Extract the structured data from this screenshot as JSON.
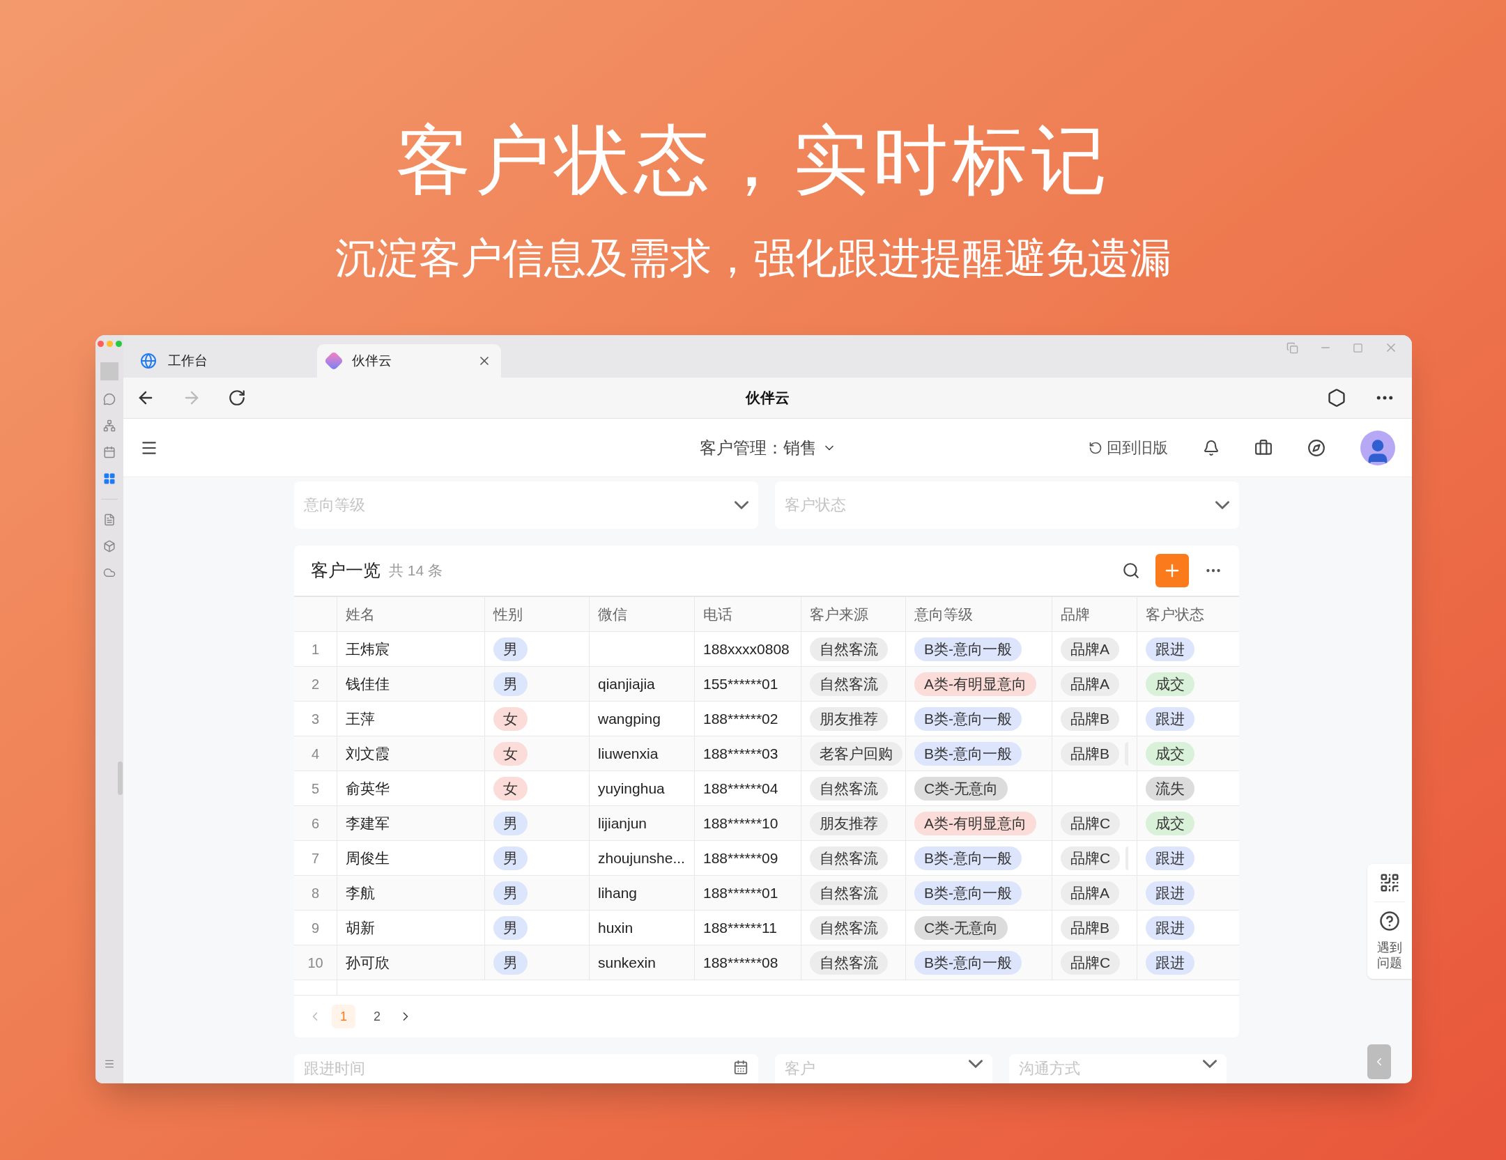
{
  "headline": "客户状态，实时标记",
  "subheadline": "沉淀客户信息及需求，强化跟进提醒避免遗漏",
  "browser": {
    "tabs": [
      {
        "label": "工作台",
        "selected": false
      },
      {
        "label": "伙伴云",
        "selected": true
      }
    ],
    "page_title": "伙伴云",
    "forward_disabled": true
  },
  "sidebar": {
    "items": [
      {
        "selected": false
      },
      {
        "selected": false
      },
      {
        "selected": false
      },
      {
        "selected": true
      },
      {
        "selected": false
      },
      {
        "selected": false
      },
      {
        "selected": false
      }
    ]
  },
  "app_header": {
    "title": "客户管理：销售",
    "legacy_link": "回到旧版"
  },
  "filters_top": [
    {
      "placeholder": "意向等级",
      "kind": "select"
    },
    {
      "placeholder": "客户状态",
      "kind": "select"
    }
  ],
  "table": {
    "title": "客户一览",
    "count": "共 14 条",
    "columns": [
      "姓名",
      "性别",
      "微信",
      "电话",
      "客户来源",
      "意向等级",
      "品牌",
      "客户状态"
    ],
    "rows": [
      {
        "index": "1",
        "name": "王炜宸",
        "gender": {
          "text": "男",
          "color": "#dbe5fc"
        },
        "wechat": "",
        "phone": "188xxxx0808",
        "source": "自然客流",
        "intent": {
          "text": "B类-意向一般",
          "color": "#dde5fd"
        },
        "brand": "品牌A",
        "more_brands": false,
        "status": {
          "text": "跟进",
          "color": "#dde5fd"
        }
      },
      {
        "index": "2",
        "name": "钱佳佳",
        "gender": {
          "text": "男",
          "color": "#dbe5fc"
        },
        "wechat": "qianjiajia",
        "phone": "155******01",
        "source": "自然客流",
        "intent": {
          "text": "A类-有明显意向",
          "color": "#fcdcd8"
        },
        "brand": "品牌A",
        "more_brands": false,
        "status": {
          "text": "成交",
          "color": "#d9f1d9"
        }
      },
      {
        "index": "3",
        "name": "王萍",
        "gender": {
          "text": "女",
          "color": "#fcdcd8"
        },
        "wechat": "wangping",
        "phone": "188******02",
        "source": "朋友推荐",
        "intent": {
          "text": "B类-意向一般",
          "color": "#dde5fd"
        },
        "brand": "品牌B",
        "more_brands": false,
        "status": {
          "text": "跟进",
          "color": "#dde5fd"
        }
      },
      {
        "index": "4",
        "name": "刘文霞",
        "gender": {
          "text": "女",
          "color": "#fcdcd8"
        },
        "wechat": "liuwenxia",
        "phone": "188******03",
        "source": "老客户回购",
        "intent": {
          "text": "B类-意向一般",
          "color": "#dde5fd"
        },
        "brand": "品牌B",
        "more_brands": true,
        "status": {
          "text": "成交",
          "color": "#d9f1d9"
        }
      },
      {
        "index": "5",
        "name": "俞英华",
        "gender": {
          "text": "女",
          "color": "#fcdcd8"
        },
        "wechat": "yuyinghua",
        "phone": "188******04",
        "source": "自然客流",
        "intent": {
          "text": "C类-无意向",
          "color": "#dcdcdc"
        },
        "brand": "",
        "more_brands": false,
        "status": {
          "text": "流失",
          "color": "#dcdcdc"
        }
      },
      {
        "index": "6",
        "name": "李建军",
        "gender": {
          "text": "男",
          "color": "#dbe5fc"
        },
        "wechat": "lijianjun",
        "phone": "188******10",
        "source": "朋友推荐",
        "intent": {
          "text": "A类-有明显意向",
          "color": "#fcdcd8"
        },
        "brand": "品牌C",
        "more_brands": false,
        "status": {
          "text": "成交",
          "color": "#d9f1d9"
        }
      },
      {
        "index": "7",
        "name": "周俊生",
        "gender": {
          "text": "男",
          "color": "#dbe5fc"
        },
        "wechat": "zhoujunshe...",
        "phone": "188******09",
        "source": "自然客流",
        "intent": {
          "text": "B类-意向一般",
          "color": "#dde5fd"
        },
        "brand": "品牌C",
        "more_brands": true,
        "status": {
          "text": "跟进",
          "color": "#dde5fd"
        }
      },
      {
        "index": "8",
        "name": "李航",
        "gender": {
          "text": "男",
          "color": "#dbe5fc"
        },
        "wechat": "lihang",
        "phone": "188******01",
        "source": "自然客流",
        "intent": {
          "text": "B类-意向一般",
          "color": "#dde5fd"
        },
        "brand": "品牌A",
        "more_brands": false,
        "status": {
          "text": "跟进",
          "color": "#dde5fd"
        }
      },
      {
        "index": "9",
        "name": "胡新",
        "gender": {
          "text": "男",
          "color": "#dbe5fc"
        },
        "wechat": "huxin",
        "phone": "188******11",
        "source": "自然客流",
        "intent": {
          "text": "C类-无意向",
          "color": "#dcdcdc"
        },
        "brand": "品牌B",
        "more_brands": false,
        "status": {
          "text": "跟进",
          "color": "#dde5fd"
        }
      },
      {
        "index": "10",
        "name": "孙可欣",
        "gender": {
          "text": "男",
          "color": "#dbe5fc"
        },
        "wechat": "sunkexin",
        "phone": "188******08",
        "source": "自然客流",
        "intent": {
          "text": "B类-意向一般",
          "color": "#dde5fd"
        },
        "brand": "品牌C",
        "more_brands": false,
        "status": {
          "text": "跟进",
          "color": "#dde5fd"
        }
      }
    ]
  },
  "pagination": {
    "pages": [
      {
        "label": "1",
        "selected": true
      },
      {
        "label": "2",
        "selected": false
      }
    ]
  },
  "filters_bottom": [
    {
      "placeholder": "跟进时间",
      "kind": "date"
    },
    {
      "placeholder": "客户",
      "kind": "select"
    },
    {
      "placeholder": "沟通方式",
      "kind": "select"
    }
  ],
  "help_panel": {
    "label": "遇到问题"
  }
}
